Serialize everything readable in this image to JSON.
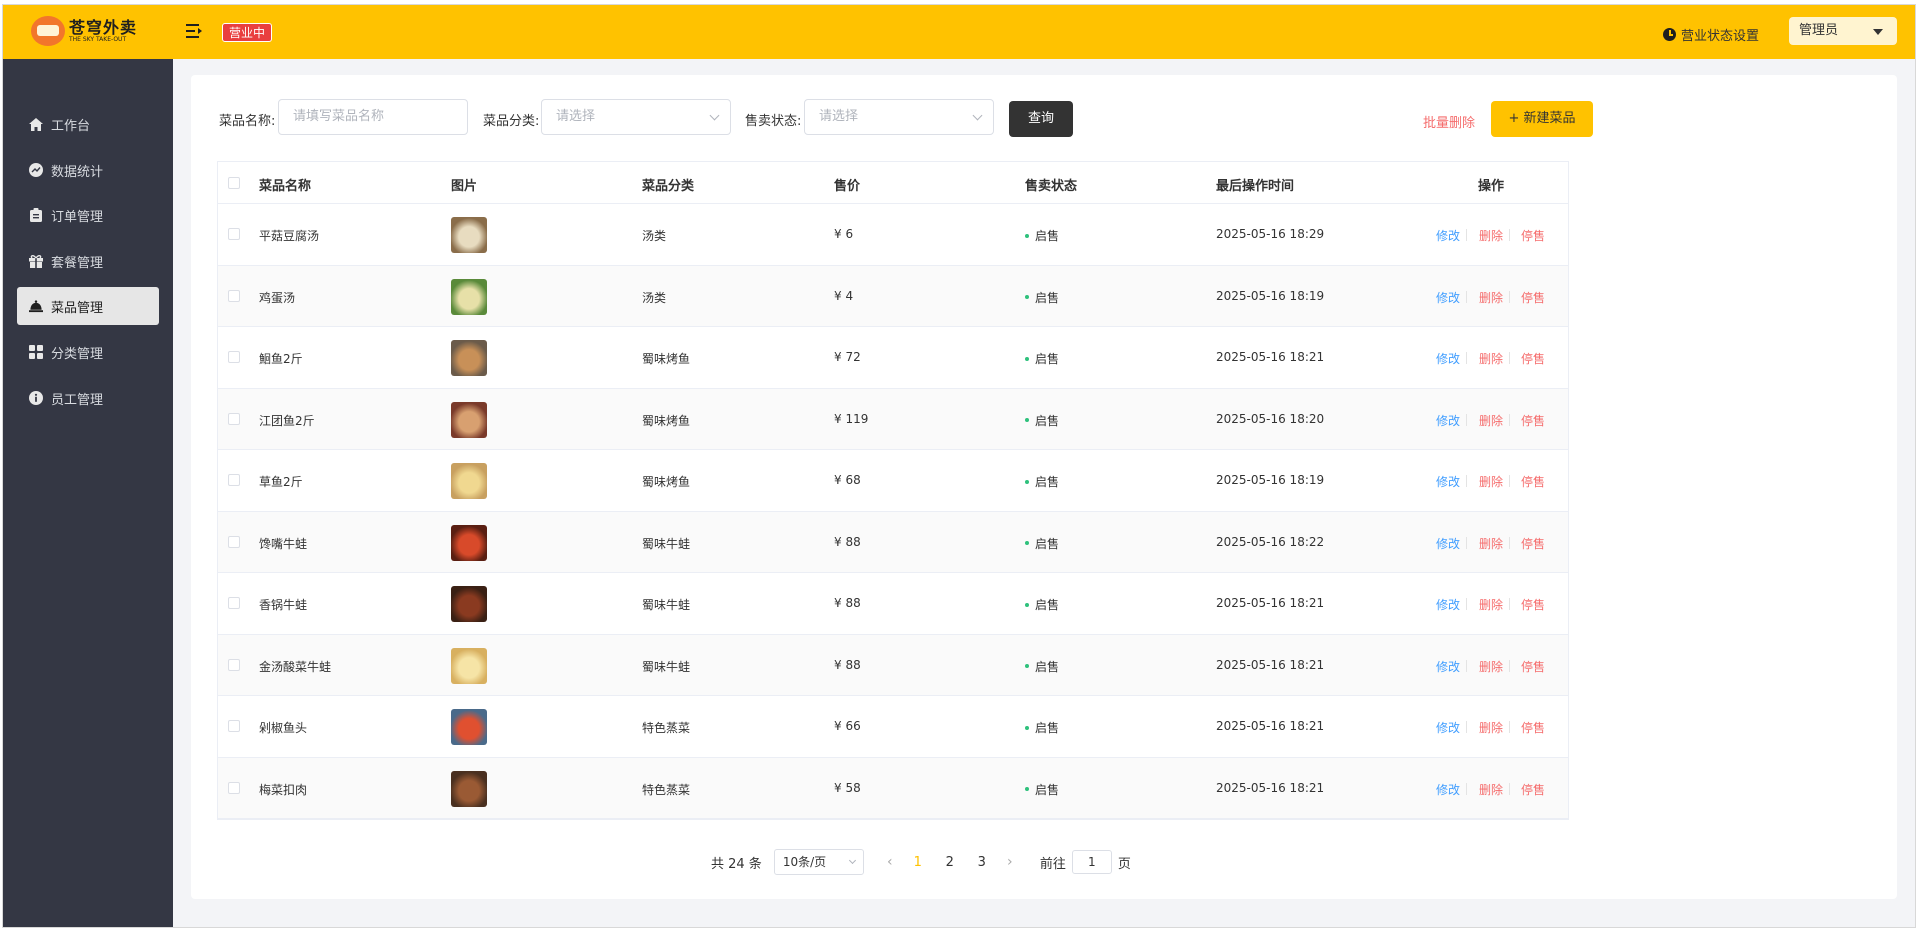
{
  "header": {
    "logo_cn": "苍穹外卖",
    "logo_en": "THE SKY TAKE-OUT",
    "status_badge": "营业中",
    "status_setting": "营业状态设置",
    "admin": "管理员"
  },
  "sidebar": {
    "items": [
      {
        "label": "工作台",
        "icon": "home-icon"
      },
      {
        "label": "数据统计",
        "icon": "chart-icon"
      },
      {
        "label": "订单管理",
        "icon": "clipboard-icon"
      },
      {
        "label": "套餐管理",
        "icon": "gift-icon"
      },
      {
        "label": "菜品管理",
        "icon": "cloche-icon",
        "active": true
      },
      {
        "label": "分类管理",
        "icon": "grid-icon"
      },
      {
        "label": "员工管理",
        "icon": "info-icon"
      }
    ]
  },
  "filters": {
    "name_label": "菜品名称:",
    "name_placeholder": "请填写菜品名称",
    "category_label": "菜品分类:",
    "category_placeholder": "请选择",
    "status_label": "售卖状态:",
    "status_placeholder": "请选择",
    "query": "查询",
    "batch_delete": "批量删除",
    "new_dish": "+ 新建菜品"
  },
  "table": {
    "headers": [
      "菜品名称",
      "图片",
      "菜品分类",
      "售价",
      "售卖状态",
      "最后操作时间",
      "操作"
    ],
    "rows": [
      {
        "name": "平菇豆腐汤",
        "category": "汤类",
        "price": "¥ 6",
        "status": "启售",
        "time": "2025-05-16 18:29"
      },
      {
        "name": "鸡蛋汤",
        "category": "汤类",
        "price": "¥ 4",
        "status": "启售",
        "time": "2025-05-16 18:19"
      },
      {
        "name": "鮰鱼2斤",
        "category": "蜀味烤鱼",
        "price": "¥ 72",
        "status": "启售",
        "time": "2025-05-16 18:21"
      },
      {
        "name": "江团鱼2斤",
        "category": "蜀味烤鱼",
        "price": "¥ 119",
        "status": "启售",
        "time": "2025-05-16 18:20"
      },
      {
        "name": "草鱼2斤",
        "category": "蜀味烤鱼",
        "price": "¥ 68",
        "status": "启售",
        "time": "2025-05-16 18:19"
      },
      {
        "name": "馋嘴牛蛙",
        "category": "蜀味牛蛙",
        "price": "¥ 88",
        "status": "启售",
        "time": "2025-05-16 18:22"
      },
      {
        "name": "香锅牛蛙",
        "category": "蜀味牛蛙",
        "price": "¥ 88",
        "status": "启售",
        "time": "2025-05-16 18:21"
      },
      {
        "name": "金汤酸菜牛蛙",
        "category": "蜀味牛蛙",
        "price": "¥ 88",
        "status": "启售",
        "time": "2025-05-16 18:21"
      },
      {
        "name": "剁椒鱼头",
        "category": "特色蒸菜",
        "price": "¥ 66",
        "status": "启售",
        "time": "2025-05-16 18:21"
      },
      {
        "name": "梅菜扣肉",
        "category": "特色蒸菜",
        "price": "¥ 58",
        "status": "启售",
        "time": "2025-05-16 18:21"
      }
    ],
    "actions": {
      "edit": "修改",
      "delete": "删除",
      "stop": "停售"
    }
  },
  "pagination": {
    "total": "共 24 条",
    "page_size": "10条/页",
    "pages": [
      "1",
      "2",
      "3"
    ],
    "goto_prefix": "前往",
    "goto_value": "1",
    "goto_suffix": "页"
  },
  "colors": {
    "brand": "#ffc200",
    "sidebar": "#343744",
    "danger": "#f56c6c",
    "link": "#419eff",
    "on_sale": "#2ec17c"
  }
}
